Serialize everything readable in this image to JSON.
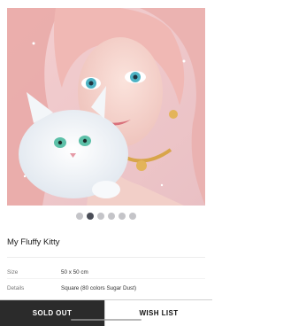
{
  "product": {
    "image_icon": "painting-image",
    "title": "My Fluffy Kitty",
    "carousel": {
      "count": 6,
      "active_index": 1
    },
    "specs": [
      {
        "label": "Size",
        "value": "50 x 50 cm"
      },
      {
        "label": "Details",
        "value": "Square (80 colors Sugar Dust)"
      }
    ]
  },
  "actions": {
    "sold_out_label": "SOLD OUT",
    "wish_list_label": "WISH LIST"
  },
  "colors": {
    "sold_out_bg": "#2b2b2b",
    "dot_active": "#4a4d57",
    "dot_inactive": "#c4c4c8"
  }
}
